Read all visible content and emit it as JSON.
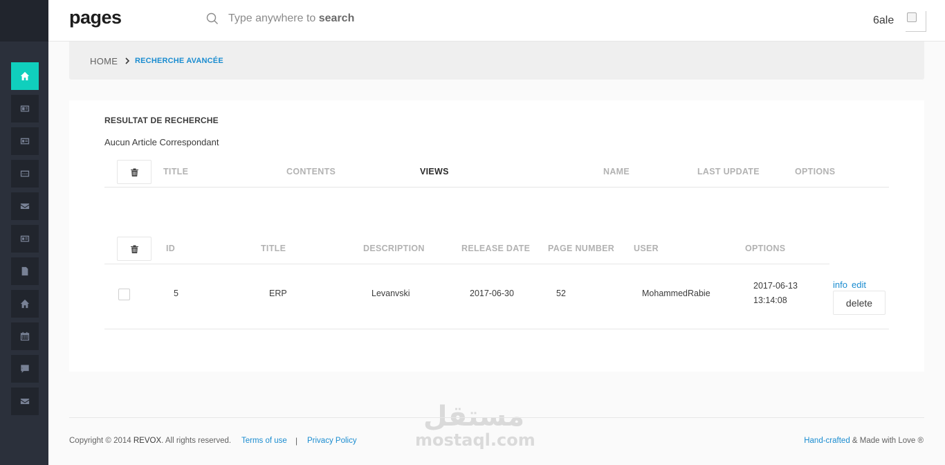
{
  "header": {
    "brand": "pages",
    "search_placeholder": "Type anywhere to search",
    "search_prefix": "Type anywhere to ",
    "search_bold": "search",
    "username": "6ale"
  },
  "sidebar": {
    "icons": [
      "home-icon",
      "card-icon",
      "id-card-icon",
      "chat-box-icon",
      "mail-icon",
      "id-card-icon",
      "file-icon",
      "home-icon",
      "calendar-icon",
      "message-icon",
      "mail-icon"
    ],
    "active_index": 0,
    "active_color": "#10cfbd"
  },
  "breadcrumb": {
    "home": "HOME",
    "current": "RECHERCHE AVANCÉE"
  },
  "results": {
    "title": "RESULTAT DE RECHERCHE",
    "message": "Aucun Article Correspondant",
    "articles_table": {
      "columns": [
        "TITLE",
        "CONTENTS",
        "VIEWS",
        "NAME",
        "LAST UPDATE",
        "OPTIONS"
      ]
    },
    "books_table": {
      "columns": [
        "ID",
        "TITLE",
        "DESCRIPTION",
        "RELEASE DATE",
        "PAGE NUMBER",
        "USER",
        "OPTIONS"
      ],
      "rows": [
        {
          "id": "5",
          "title": "ERP",
          "description": "Levanvski",
          "release_date": "2017-06-30",
          "page_number": "52",
          "user": "MohammedRabie",
          "date_line1": "2017-06-13",
          "date_line2": "13:14:08",
          "info_label": "info",
          "edit_label": "edit",
          "delete_label": "delete"
        }
      ]
    }
  },
  "footer": {
    "copyright_prefix": "Copyright © 2014 ",
    "company": "REVOX",
    "rights": ". All rights reserved.",
    "terms": "Terms of use",
    "separator": "|",
    "privacy": "Privacy Policy",
    "handcrafted": "Hand-crafted",
    "made_with": " & Made with Love ®"
  },
  "watermark": {
    "arabic": "مستقل",
    "latin": "mostaql.com"
  }
}
